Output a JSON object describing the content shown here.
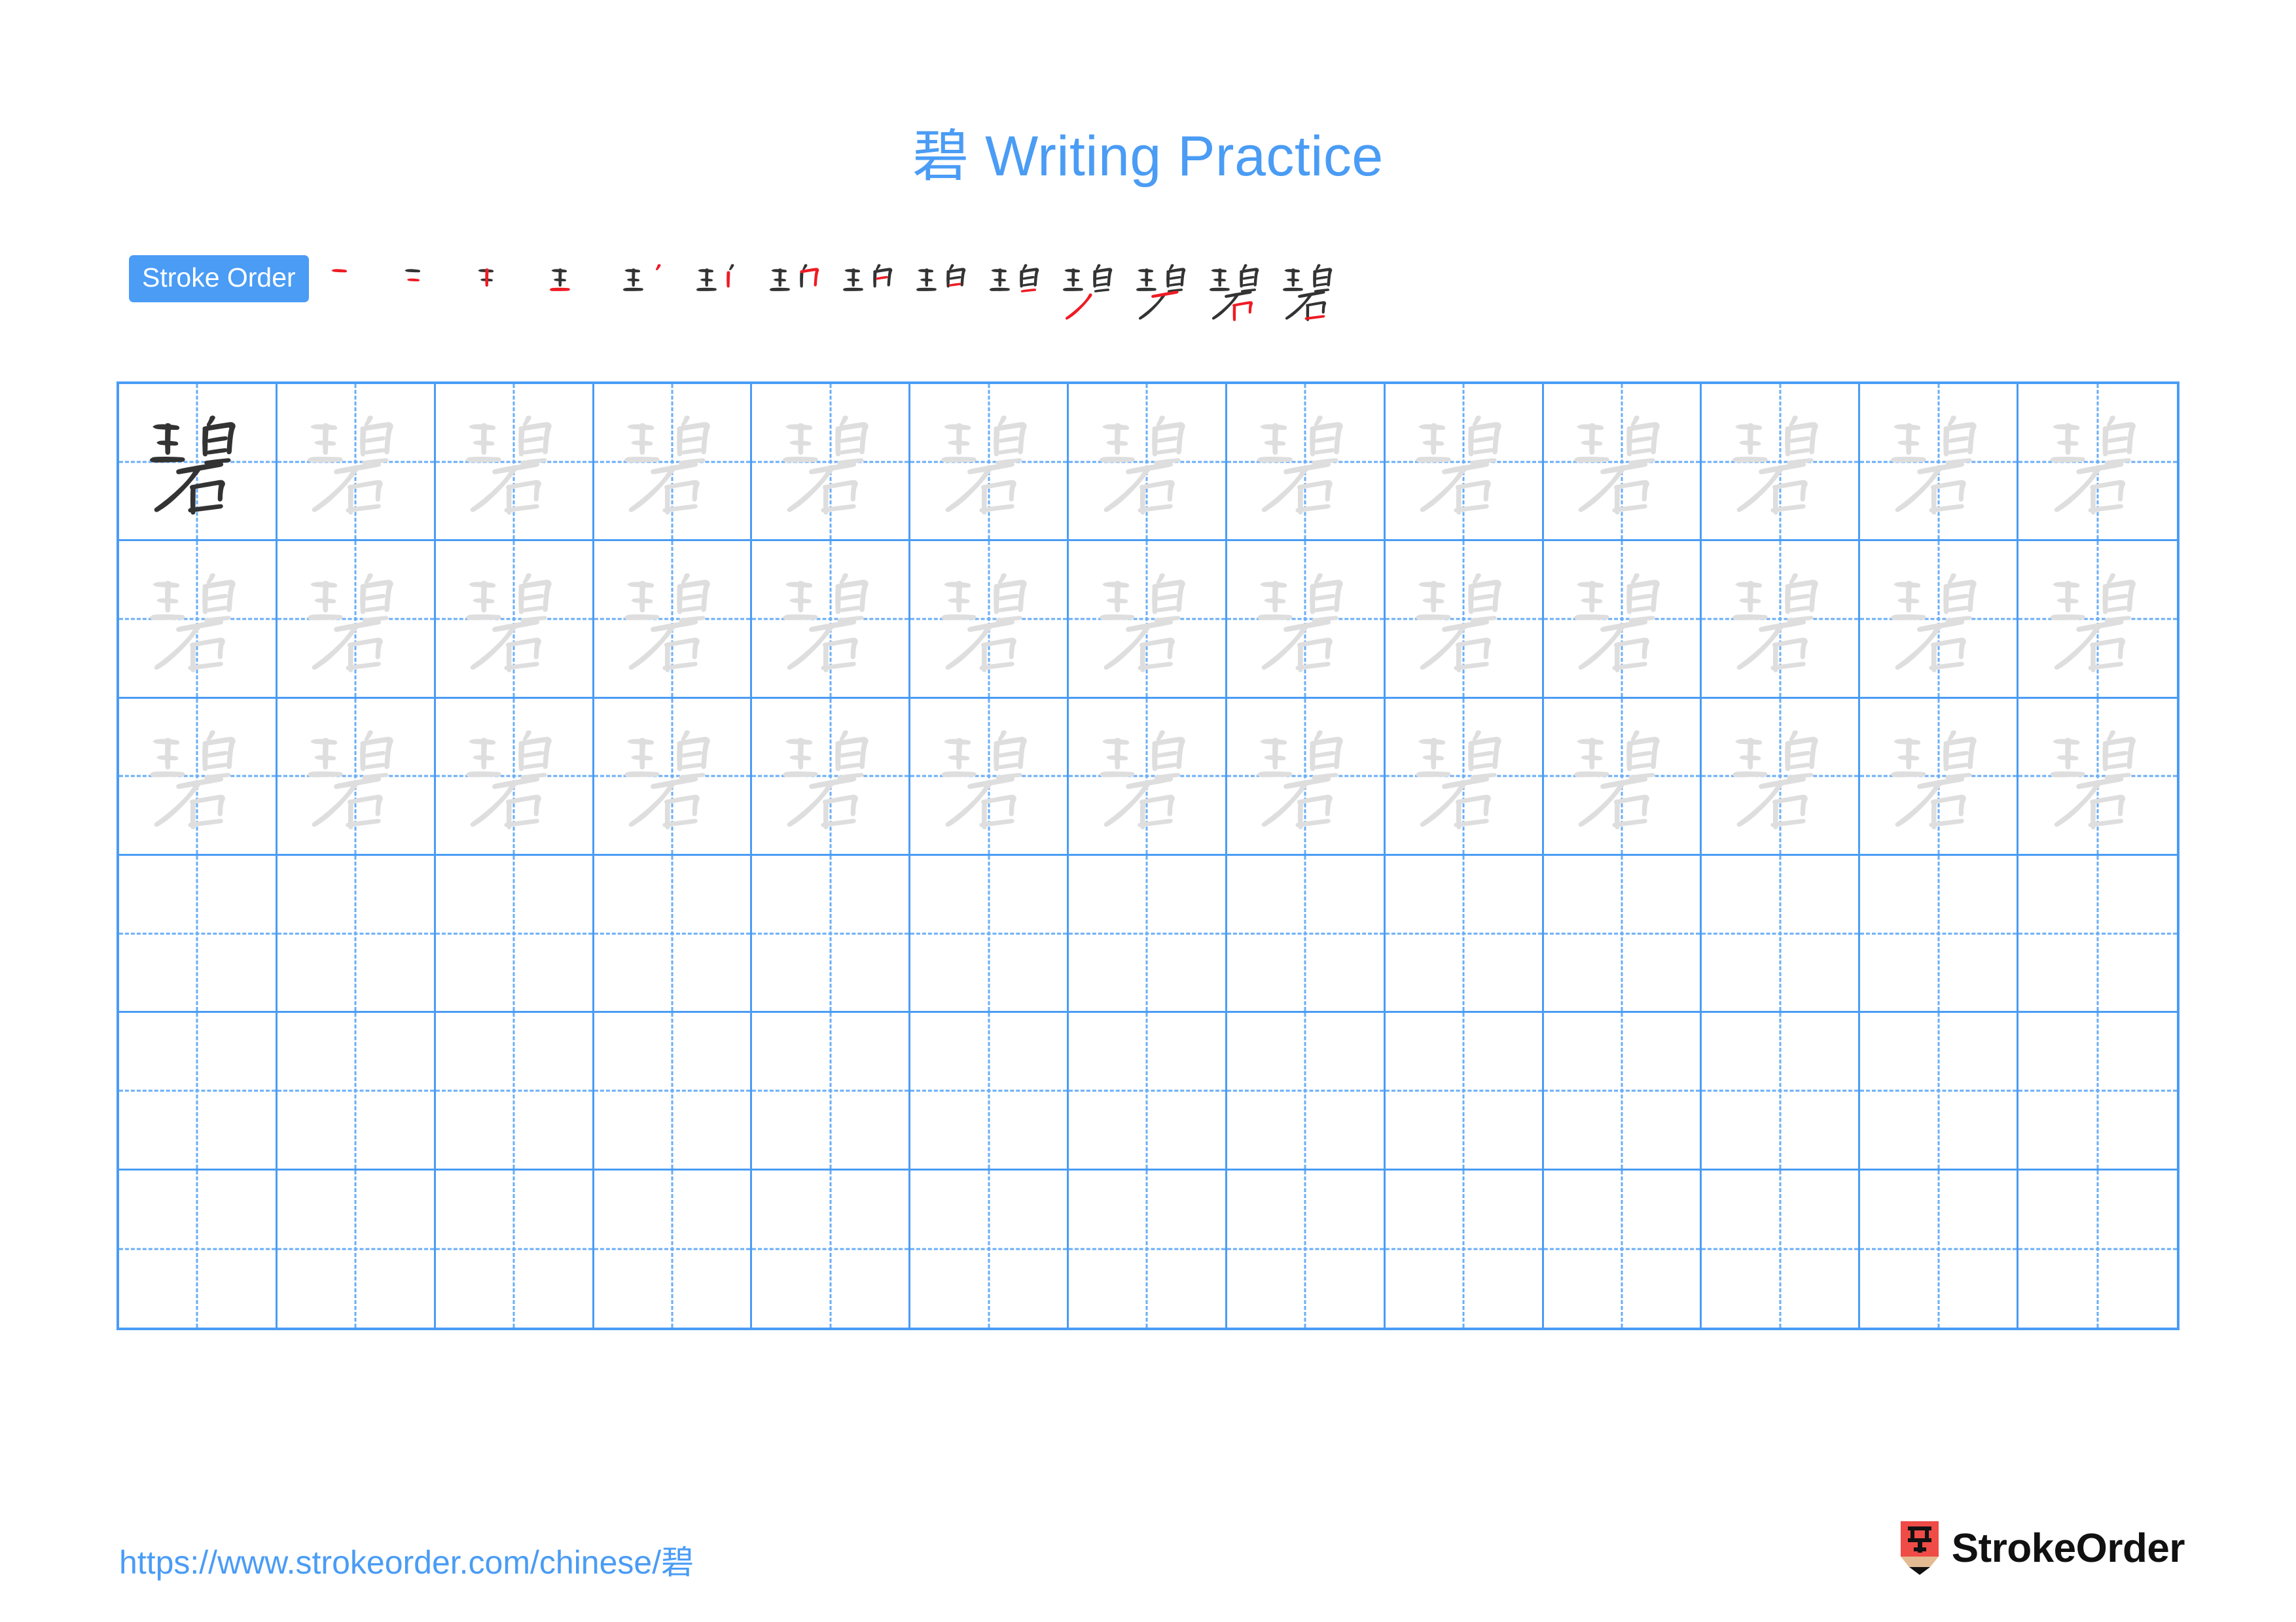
{
  "page": {
    "character": "碧",
    "title": "碧 Writing Practice",
    "title_char": "碧",
    "title_text": " Writing Practice",
    "accent_color": "#4a9cf5",
    "grid_line_color": "#4a9cf5",
    "dashed_guide_color": "#6aaef7",
    "example_stroke_color": "#333333",
    "trace_stroke_color": "#dedede",
    "new_stroke_color": "#ee1b24"
  },
  "stroke_order": {
    "label": "Stroke Order",
    "total_strokes": 14,
    "steps": [
      {
        "index": 1,
        "new_stroke": "横",
        "cumulative": "一"
      },
      {
        "index": 2,
        "new_stroke": "横",
        "cumulative": "二"
      },
      {
        "index": 3,
        "new_stroke": "竖",
        "cumulative": "干"
      },
      {
        "index": 4,
        "new_stroke": "提",
        "cumulative": "王"
      },
      {
        "index": 5,
        "new_stroke": "撇",
        "cumulative": "王丿"
      },
      {
        "index": 6,
        "new_stroke": "竖",
        "cumulative": "玑"
      },
      {
        "index": 7,
        "new_stroke": "横折钩",
        "cumulative": "玓"
      },
      {
        "index": 8,
        "new_stroke": "横",
        "cumulative": "珀"
      },
      {
        "index": 9,
        "new_stroke": "横",
        "cumulative": "珀"
      },
      {
        "index": 10,
        "new_stroke": "横",
        "cumulative": "珇"
      },
      {
        "index": 11,
        "new_stroke": "撇",
        "cumulative": "珼"
      },
      {
        "index": 12,
        "new_stroke": "竖",
        "cumulative": "碧"
      },
      {
        "index": 13,
        "new_stroke": "横折",
        "cumulative": "碧"
      },
      {
        "index": 14,
        "new_stroke": "横",
        "cumulative": "碧"
      }
    ]
  },
  "practice_grid": {
    "columns": 13,
    "rows": 6,
    "row_types": [
      "example-then-trace",
      "trace",
      "trace",
      "blank",
      "blank",
      "blank"
    ],
    "example_cell": {
      "row": 1,
      "column": 1
    },
    "trace_character": "碧",
    "blank_row_count": 3
  },
  "footer": {
    "url": "https://www.strokeorder.com/chinese/碧",
    "brand_name": "StrokeOrder",
    "brand_mark_character": "字",
    "brand_mark_body_color": "#ef4b47",
    "brand_mark_wood_color": "#e3bb92",
    "brand_mark_tip_color": "#111111"
  }
}
